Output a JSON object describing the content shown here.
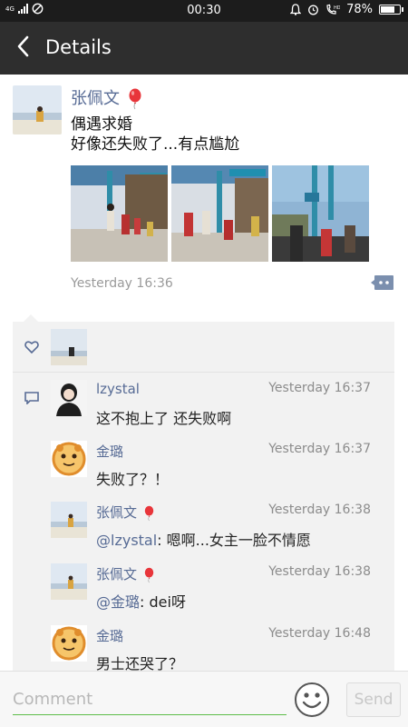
{
  "status_bar": {
    "network": "4G",
    "time": "00:30",
    "battery": "78%",
    "battery_level": 0.78
  },
  "navbar": {
    "title": "Details"
  },
  "post": {
    "author": "张佩文",
    "text_line1": "偶遇求婚",
    "text_line2": "好像还失败了...有点尴尬",
    "time": "Yesterday 16:36"
  },
  "comments": [
    {
      "name": "lzystal",
      "time": "Yesterday 16:37",
      "text": "这不抱上了 还失败啊"
    },
    {
      "name": "金璐",
      "time": "Yesterday 16:37",
      "text": "失败了？！"
    },
    {
      "name": "张佩文",
      "time": "Yesterday 16:38",
      "mention": "@lzystal",
      "text": ": 嗯啊...女主一脸不情愿"
    },
    {
      "name": "张佩文",
      "time": "Yesterday 16:38",
      "mention": "@金璐",
      "text": ": dei呀"
    },
    {
      "name": "金璐",
      "time": "Yesterday 16:48",
      "text": "男士还哭了？"
    }
  ],
  "input": {
    "placeholder": "Comment",
    "send_label": "Send"
  },
  "colors": {
    "link": "#576b95",
    "nav_bg": "#2e2e2e",
    "status_bg": "#1c1c1c",
    "accent": "#5ebd4a"
  }
}
